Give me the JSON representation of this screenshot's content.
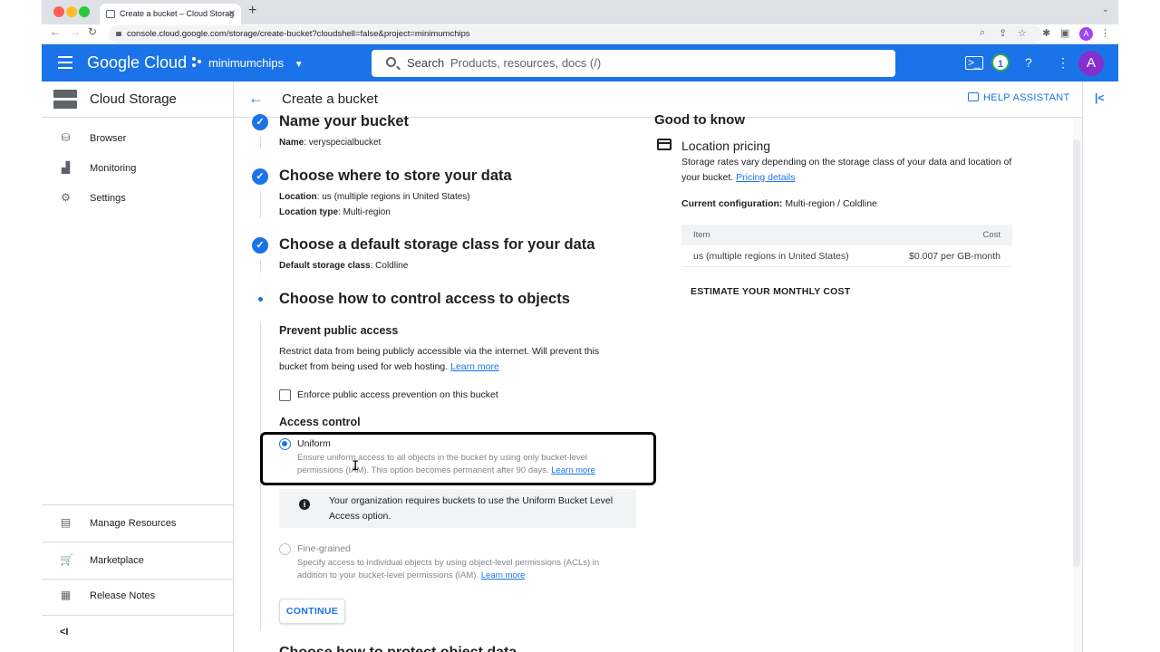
{
  "browser": {
    "tab_title": "Create a bucket – Cloud Storag",
    "url": "console.cloud.google.com/storage/create-bucket?cloudshell=false&project=minimumchips",
    "profile_initial": "A"
  },
  "header": {
    "logo": "Google Cloud",
    "project": "minimumchips",
    "search_label": "Search",
    "search_placeholder": "Products, resources, docs (/)",
    "notification_count": "1",
    "avatar_initial": "A"
  },
  "sidebar": {
    "title": "Cloud Storage",
    "items": [
      {
        "label": "Browser",
        "icon": "bucket-icon"
      },
      {
        "label": "Monitoring",
        "icon": "chart-icon"
      },
      {
        "label": "Settings",
        "icon": "gear-icon"
      }
    ],
    "bottom_items": [
      {
        "label": "Manage Resources",
        "icon": "folder-gear-icon"
      },
      {
        "label": "Marketplace",
        "icon": "cart-icon"
      },
      {
        "label": "Release Notes",
        "icon": "notes-icon"
      }
    ],
    "collapse_label": "<I"
  },
  "page": {
    "title": "Create a bucket",
    "help_assistant": "HELP ASSISTANT"
  },
  "steps": {
    "name": {
      "title": "Name your bucket",
      "key": "Name",
      "value": ": veryspecialbucket"
    },
    "location": {
      "title": "Choose where to store your data",
      "line1_key": "Location",
      "line1_value": ": us (multiple regions in United States)",
      "line2_key": "Location type",
      "line2_value": ": Multi-region"
    },
    "storage_class": {
      "title": "Choose a default storage class for your data",
      "key": "Default storage class",
      "value": ": Coldline"
    },
    "access": {
      "title": "Choose how to control access to objects"
    }
  },
  "prevent_public": {
    "heading": "Prevent public access",
    "text": "Restrict data from being publicly accessible via the internet. Will prevent this bucket from being used for web hosting.",
    "learn_more": "Learn more",
    "checkbox_label": "Enforce public access prevention on this bucket",
    "checked": false
  },
  "access_control": {
    "heading": "Access control",
    "uniform_label": "Uniform",
    "uniform_desc": "Ensure uniform access to all objects in the bucket by using only bucket-level permissions (IAM). This option becomes permanent after 90 days.",
    "uniform_learn_more": "Learn more",
    "info_text": "Your organization requires buckets to use the Uniform Bucket Level Access option.",
    "fine_label": "Fine-grained",
    "fine_desc": "Specify access to individual objects by using object-level permissions (ACLs) in addition to your bucket-level permissions (IAM).",
    "fine_learn_more": "Learn more",
    "selected": "Uniform"
  },
  "continue_label": "CONTINUE",
  "next_step_partial": "Choose how to protect object data",
  "good_to_know": {
    "title": "Good to know",
    "pricing_title": "Location pricing",
    "pricing_text": "Storage rates vary depending on the storage class of your data and location of your bucket.",
    "pricing_link": "Pricing details",
    "current_config_key": "Current configuration:",
    "current_config_value": " Multi-region / Coldline",
    "table": {
      "headers": [
        "Item",
        "Cost"
      ],
      "rows": [
        [
          "us (multiple regions in United States)",
          "$0.007 per GB-month"
        ]
      ]
    },
    "estimate": "ESTIMATE YOUR MONTHLY COST"
  },
  "colors": {
    "brand_blue": "#1a73e8",
    "text": "#202124",
    "muted": "#80868b"
  }
}
